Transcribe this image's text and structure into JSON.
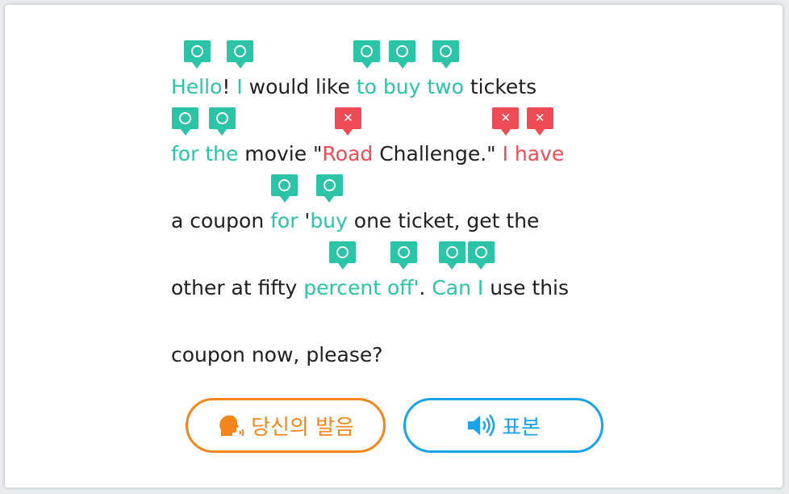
{
  "passage": {
    "lines": [
      [
        {
          "text": "Hello",
          "status": "correct"
        },
        {
          "text": "! ",
          "status": "plain"
        },
        {
          "text": "I",
          "status": "correct"
        },
        {
          "text": " would like ",
          "status": "plain"
        },
        {
          "text": "to",
          "status": "correct"
        },
        {
          "text": " ",
          "status": "plain"
        },
        {
          "text": "buy",
          "status": "correct"
        },
        {
          "text": " ",
          "status": "plain"
        },
        {
          "text": "two",
          "status": "correct"
        },
        {
          "text": " tickets",
          "status": "plain"
        }
      ],
      [
        {
          "text": "for",
          "status": "correct"
        },
        {
          "text": " ",
          "status": "plain"
        },
        {
          "text": "the",
          "status": "correct"
        },
        {
          "text": " movie \"",
          "status": "plain"
        },
        {
          "text": "Road",
          "status": "wrong"
        },
        {
          "text": " Challenge.\" ",
          "status": "plain"
        },
        {
          "text": "I",
          "status": "wrong"
        },
        {
          "text": " ",
          "status": "plain"
        },
        {
          "text": "have",
          "status": "wrong"
        }
      ],
      [
        {
          "text": "a coupon ",
          "status": "plain"
        },
        {
          "text": "for",
          "status": "correct"
        },
        {
          "text": " '",
          "status": "plain"
        },
        {
          "text": "buy",
          "status": "correct"
        },
        {
          "text": " one ticket, get the",
          "status": "plain"
        }
      ],
      [
        {
          "text": "other at fifty ",
          "status": "plain"
        },
        {
          "text": "percent",
          "status": "correct"
        },
        {
          "text": " ",
          "status": "plain"
        },
        {
          "text": "off'",
          "status": "correct"
        },
        {
          "text": ". ",
          "status": "plain"
        },
        {
          "text": "Can",
          "status": "correct"
        },
        {
          "text": " ",
          "status": "plain"
        },
        {
          "text": "I",
          "status": "correct"
        },
        {
          "text": " use this",
          "status": "plain"
        }
      ],
      [
        {
          "text": "coupon now, please?",
          "status": "plain"
        }
      ]
    ]
  },
  "buttons": {
    "my_pronunciation": {
      "label": "당신의 발음",
      "icon": "speaking-head-icon"
    },
    "sample": {
      "label": "표본",
      "icon": "speaker-icon"
    }
  },
  "colors": {
    "correct": "#2bc4a6",
    "wrong": "#ef4b57",
    "plain_text": "#1f1f1f",
    "my_button": "#f2861d",
    "sample_button": "#1aa3e8"
  }
}
